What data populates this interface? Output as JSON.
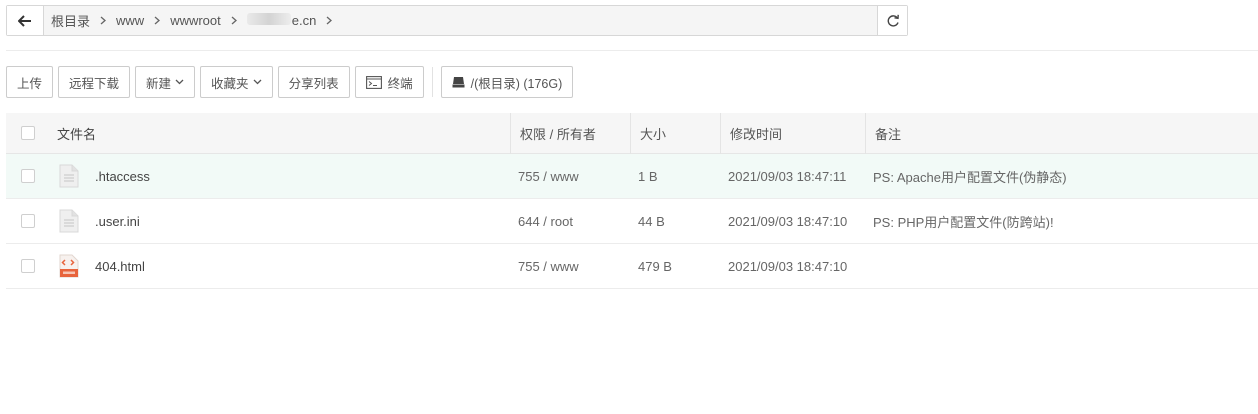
{
  "breadcrumb": {
    "back_icon": "arrow-left-icon",
    "root": "根目录",
    "items": [
      "www",
      "wwwroot"
    ],
    "domain_visible": "e.cn",
    "refresh_icon": "refresh-icon"
  },
  "toolbar": {
    "upload": "上传",
    "remote_download": "远程下载",
    "new": "新建",
    "favorites": "收藏夹",
    "share_list": "分享列表",
    "terminal": "终端",
    "disk": "/(根目录) (176G)"
  },
  "table": {
    "headers": {
      "name": "文件名",
      "perm": "权限 / 所有者",
      "size": "大小",
      "mtime": "修改时间",
      "note": "备注"
    },
    "rows": [
      {
        "name": ".htaccess",
        "perm": "755 / www",
        "size": "1 B",
        "mtime": "2021/09/03 18:47:11",
        "note": "PS: Apache用户配置文件(伪静态)",
        "icon": "text-file-icon"
      },
      {
        "name": ".user.ini",
        "perm": "644 / root",
        "size": "44 B",
        "mtime": "2021/09/03 18:47:10",
        "note": "PS: PHP用户配置文件(防跨站)!",
        "icon": "text-file-icon"
      },
      {
        "name": "404.html",
        "perm": "755 / www",
        "size": "479 B",
        "mtime": "2021/09/03 18:47:10",
        "note": "",
        "icon": "html-file-icon"
      }
    ]
  },
  "colors": {
    "selected_row": "#f2faf7",
    "html_icon": "#e8643c",
    "header_bg": "#f6f6f6"
  }
}
